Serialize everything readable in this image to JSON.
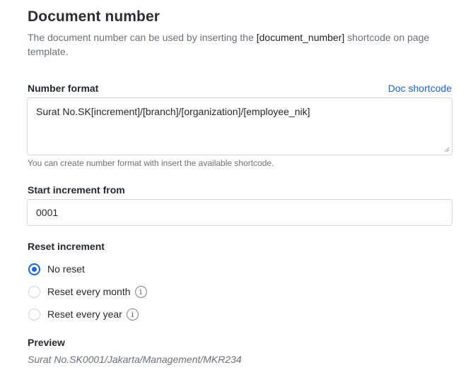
{
  "header": {
    "title": "Document number",
    "description_prefix": "The document number can be used by inserting the ",
    "description_code": "[document_number]",
    "description_suffix": " shortcode on page template."
  },
  "number_format": {
    "label": "Number format",
    "link": "Doc shortcode",
    "value": "Surat No.SK[increment]/[branch]/[organization]/[employee_nik]",
    "help": "You can create number format with insert the available shortcode."
  },
  "start_increment": {
    "label": "Start increment from",
    "value": "0001"
  },
  "reset_increment": {
    "label": "Reset increment",
    "options": [
      {
        "label": "No reset",
        "checked": true
      },
      {
        "label": "Reset every month",
        "checked": false,
        "icon": "info-icon"
      },
      {
        "label": "Reset every year",
        "checked": false,
        "icon": "info-icon"
      }
    ]
  },
  "preview": {
    "label": "Preview",
    "value": "Surat No.SK0001/Jakarta/Management/MKR234"
  },
  "colors": {
    "accent": "#1a63d8",
    "muted_text": "#6b7178",
    "border": "#d5d8dc"
  }
}
